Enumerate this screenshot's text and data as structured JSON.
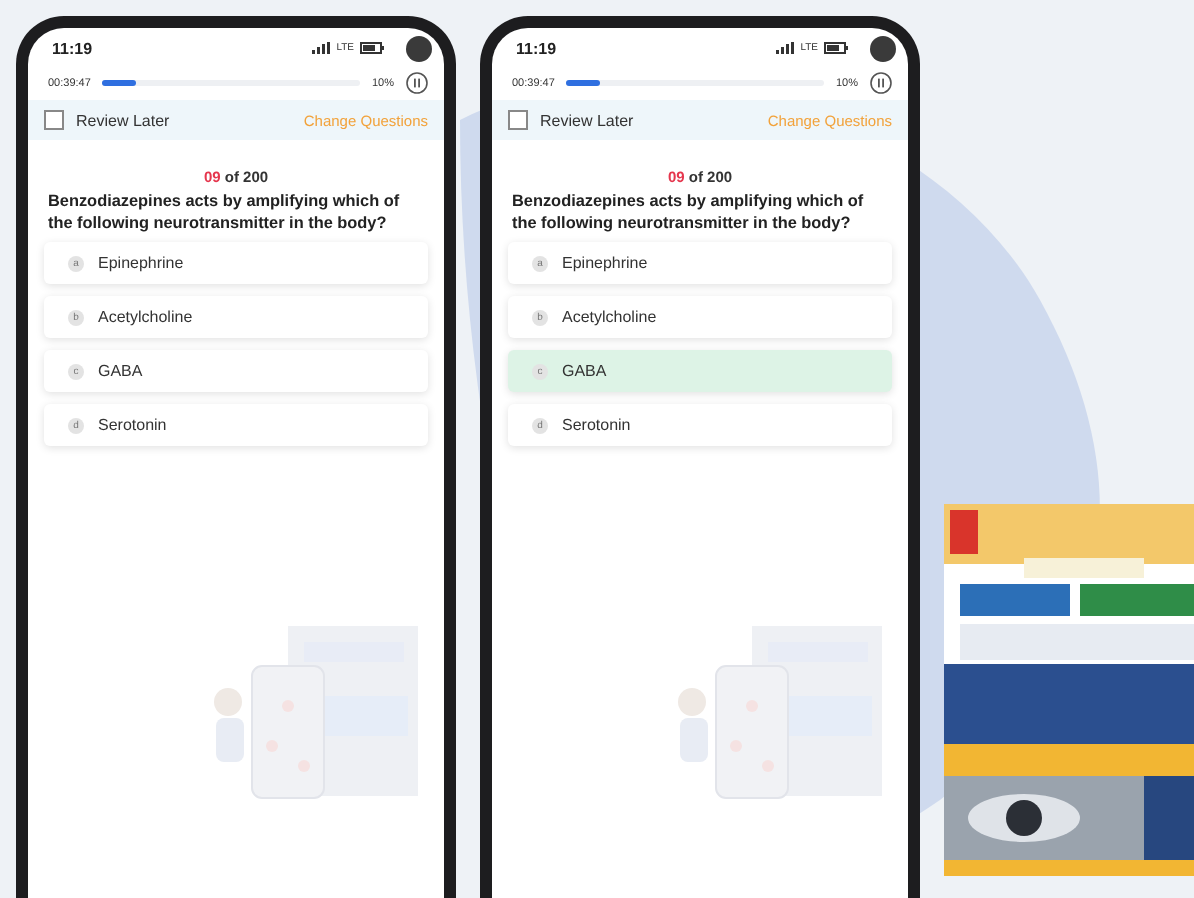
{
  "phones": [
    {
      "status_time": "11:19",
      "network": "LTE",
      "timer": "00:39:47",
      "progress": {
        "level": 0.13
      },
      "percent": "10%",
      "review_later": {
        "label": "Review Later",
        "checked": false
      },
      "change_questions": "Change Questions",
      "counter": {
        "current": "09",
        "total": "of 200"
      },
      "question": "Benzodiazepines acts by amplifying which of the following neurotransmitter in the body?",
      "options": [
        {
          "letter": "a",
          "text": "Epinephrine",
          "selected": false
        },
        {
          "letter": "b",
          "text": "Acetylcholine",
          "selected": false
        },
        {
          "letter": "c",
          "text": "GABA",
          "selected": false
        },
        {
          "letter": "d",
          "text": "Serotonin",
          "selected": false
        }
      ]
    },
    {
      "status_time": "11:19",
      "network": "LTE",
      "timer": "00:39:47",
      "progress": {
        "level": 0.13
      },
      "percent": "10%",
      "review_later": {
        "label": "Review Later",
        "checked": false
      },
      "change_questions": "Change Questions",
      "counter": {
        "current": "09",
        "total": "of 200"
      },
      "question": "Benzodiazepines acts by amplifying which of the following neurotransmitter in the body?",
      "options": [
        {
          "letter": "a",
          "text": "Epinephrine",
          "selected": false
        },
        {
          "letter": "b",
          "text": "Acetylcholine",
          "selected": false
        },
        {
          "letter": "c",
          "text": "GABA",
          "selected": true
        },
        {
          "letter": "d",
          "text": "Serotonin",
          "selected": false
        }
      ]
    }
  ]
}
